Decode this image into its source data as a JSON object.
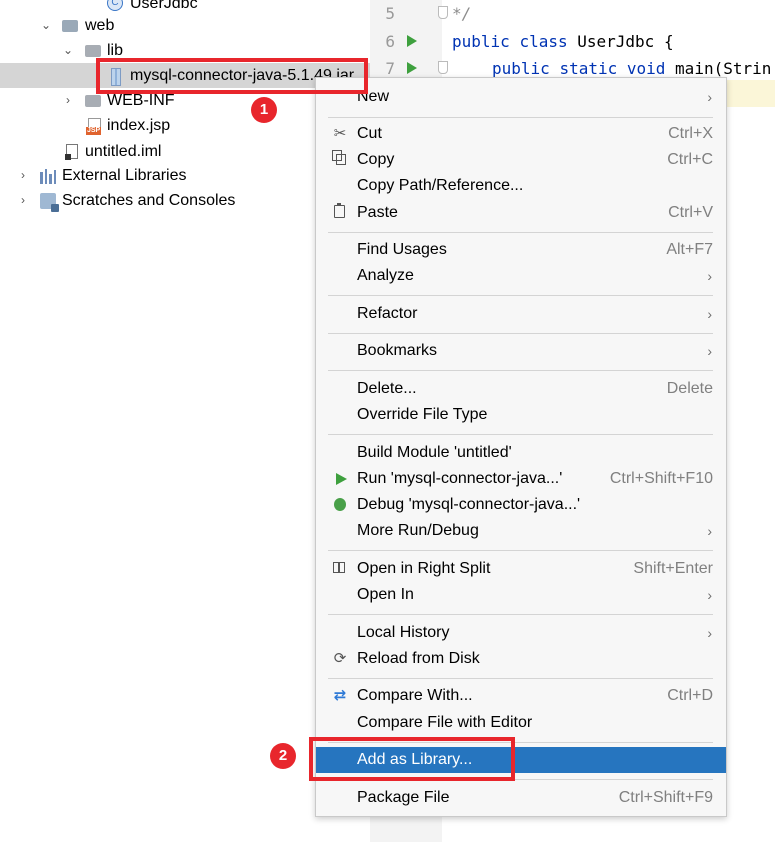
{
  "tree": {
    "items": [
      {
        "label": "UserJdbc",
        "icon": "java-class-icon"
      },
      {
        "label": "web",
        "icon": "web-folder-icon"
      },
      {
        "label": "lib",
        "icon": "folder-icon"
      },
      {
        "label": "mysql-connector-java-5.1.49.jar",
        "icon": "jar-icon"
      },
      {
        "label": "WEB-INF",
        "icon": "folder-icon"
      },
      {
        "label": "index.jsp",
        "icon": "jsp-file-icon"
      },
      {
        "label": "untitled.iml",
        "icon": "iml-file-icon"
      },
      {
        "label": "External Libraries",
        "icon": "external-libraries-icon"
      },
      {
        "label": "Scratches and Consoles",
        "icon": "scratches-icon"
      }
    ],
    "class_icon_letter": "C",
    "jsp_badge": "JSP"
  },
  "editor": {
    "lines": [
      {
        "num": "5",
        "comment": "*/"
      },
      {
        "num": "6",
        "kw1": "public",
        "kw2": "class",
        "rest": "UserJdbc {"
      },
      {
        "num": "7",
        "kw1": "public",
        "kw2": "static",
        "kw3": "void",
        "rest": "main(Strin"
      }
    ]
  },
  "menu": {
    "items": [
      {
        "label": "New",
        "shortcut": "",
        "submenu": true
      },
      {
        "label": "Cut",
        "shortcut": "Ctrl+X",
        "icon": "cut-icon"
      },
      {
        "label": "Copy",
        "shortcut": "Ctrl+C",
        "icon": "copy-icon"
      },
      {
        "label": "Copy Path/Reference...",
        "shortcut": ""
      },
      {
        "label": "Paste",
        "shortcut": "Ctrl+V",
        "icon": "paste-icon"
      },
      {
        "label": "Find Usages",
        "shortcut": "Alt+F7"
      },
      {
        "label": "Analyze",
        "shortcut": "",
        "submenu": true
      },
      {
        "label": "Refactor",
        "shortcut": "",
        "submenu": true
      },
      {
        "label": "Bookmarks",
        "shortcut": "",
        "submenu": true
      },
      {
        "label": "Delete...",
        "shortcut": "Delete"
      },
      {
        "label": "Override File Type",
        "shortcut": ""
      },
      {
        "label": "Build Module 'untitled'",
        "shortcut": ""
      },
      {
        "label": "Run 'mysql-connector-java...'",
        "shortcut": "Ctrl+Shift+F10",
        "icon": "run-icon"
      },
      {
        "label": "Debug 'mysql-connector-java...'",
        "shortcut": "",
        "icon": "debug-icon"
      },
      {
        "label": "More Run/Debug",
        "shortcut": "",
        "submenu": true
      },
      {
        "label": "Open in Right Split",
        "shortcut": "Shift+Enter",
        "icon": "split-icon"
      },
      {
        "label": "Open In",
        "shortcut": "",
        "submenu": true
      },
      {
        "label": "Local History",
        "shortcut": "",
        "submenu": true
      },
      {
        "label": "Reload from Disk",
        "shortcut": "",
        "icon": "reload-icon"
      },
      {
        "label": "Compare With...",
        "shortcut": "Ctrl+D",
        "icon": "compare-icon"
      },
      {
        "label": "Compare File with Editor",
        "shortcut": ""
      },
      {
        "label": "Add as Library...",
        "shortcut": "",
        "active": true
      },
      {
        "label": "Package File",
        "shortcut": "Ctrl+Shift+F9"
      }
    ],
    "submenu_arrow": "›"
  },
  "annotations": {
    "badge1": "1",
    "badge2": "2",
    "highlight_color": "#e8262c"
  },
  "colors": {
    "menu_active": "#2675bf",
    "selection": "#d5d5d5",
    "keyword": "#0033b3",
    "run_green": "#3ea03e"
  }
}
